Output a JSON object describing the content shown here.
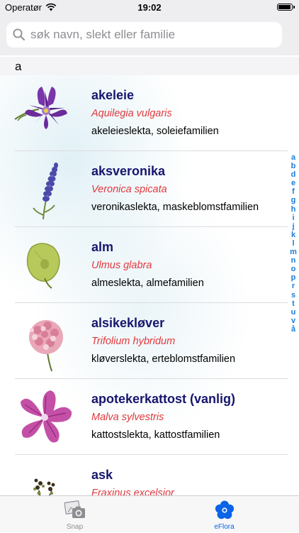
{
  "status_bar": {
    "carrier": "Operatør",
    "time": "19:02"
  },
  "search": {
    "placeholder": "søk navn, slekt eller familie",
    "value": ""
  },
  "section_header": "a",
  "species": [
    {
      "name": "akeleie",
      "latin": "Aquilegia vulgaris",
      "family": "akeleieslekta, soleiefamilien",
      "icon": "columbine-flower-icon"
    },
    {
      "name": "aksveronika",
      "latin": "Veronica spicata",
      "family": "veronikaslekta, maskeblomstfamilien",
      "icon": "spiked-speedwell-icon"
    },
    {
      "name": "alm",
      "latin": "Ulmus glabra",
      "family": "almeslekta, almefamilien",
      "icon": "elm-seed-icon"
    },
    {
      "name": "alsikekløver",
      "latin": "Trifolium hybridum",
      "family": "kløverslekta, erteblomstfamilien",
      "icon": "clover-flower-icon"
    },
    {
      "name": "apotekerkattost (vanlig)",
      "latin": "Malva sylvestris",
      "family": "kattostslekta, kattostfamilien",
      "icon": "mallow-flower-icon"
    },
    {
      "name": "ask",
      "latin": "Fraxinus excelsior",
      "family": "",
      "icon": "ash-flower-icon"
    }
  ],
  "index_letters": [
    "a",
    "b",
    "d",
    "e",
    "f",
    "g",
    "h",
    "i",
    "j",
    "k",
    "l",
    "m",
    "n",
    "o",
    "p",
    "r",
    "s",
    "t",
    "u",
    "v",
    "å"
  ],
  "tab_bar": {
    "tabs": [
      {
        "label": "Snap",
        "icon": "camera-photo-icon",
        "selected": false
      },
      {
        "label": "eFlora",
        "icon": "flower-icon",
        "selected": true
      }
    ]
  },
  "colors": {
    "name": "#16166e",
    "latin": "#e0393e",
    "index": "#1a7cd9",
    "tab_selected": "#0a64e6"
  }
}
